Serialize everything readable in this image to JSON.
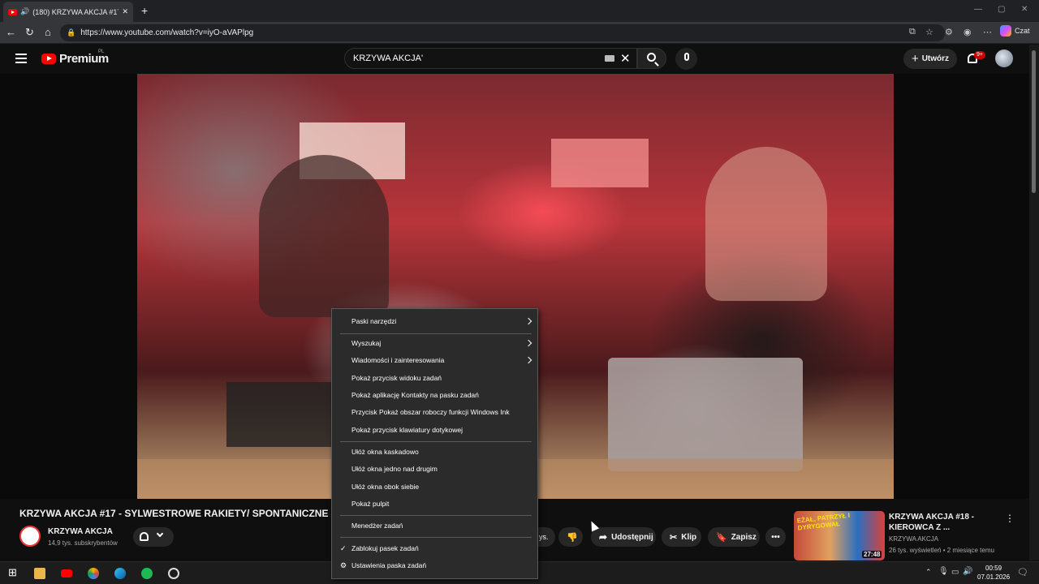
{
  "browser": {
    "tab_title": "(180) KRZYWA AKCJA #17 - SYLWESTROWE RAKIETY",
    "new_tab": "+",
    "close_tab": "✕",
    "url": "https://www.youtube.com/watch?v=iyO-aVAPlpg",
    "chat_label": "Czat",
    "window_min": "—",
    "window_max": "▢",
    "window_close": "✕"
  },
  "youtube": {
    "logo_text": "Premium",
    "logo_region": "PL",
    "search_value": "KRZYWA AKCJA'",
    "create_label": "Utwórz",
    "notifications_badge": "9+"
  },
  "video": {
    "title": "KRZYWA AKCJA #17 - SYLWESTROWE RAKIETY/ SPONTANICZNE",
    "channel_name": "KRZYWA AKCJA",
    "subscribers": "14,9 tys. subskrybentów",
    "likes_fragment": "ys.",
    "share_label": "Udostępnij",
    "clip_label": "Klip",
    "save_label": "Zapisz",
    "more_label": "•••"
  },
  "recommendation": {
    "thumb_text": "EŻAŁ, PATRZYŁ I DYRYGOWAŁ",
    "duration": "27:48",
    "title": "KRZYWA AKCJA #18 - KIEROWCA Z ...",
    "channel": "KRZYWA AKCJA",
    "meta": "26 tys. wyświetleń • 2 miesiące temu",
    "menu": "⋮"
  },
  "context_menu": {
    "items": [
      {
        "label": "Paski narzędzi",
        "submenu": true
      },
      {
        "label": "Wyszukaj",
        "submenu": true
      },
      {
        "label": "Wiadomości i zainteresowania",
        "submenu": true
      },
      {
        "label": "Pokaż przycisk widoku zadań"
      },
      {
        "label": "Pokaż aplikację Kontakty na pasku zadań"
      },
      {
        "label": "Przycisk Pokaż obszar roboczy funkcji Windows Ink"
      },
      {
        "label": "Pokaż przycisk klawiatury dotykowej"
      },
      {
        "label": "Ułóż okna kaskadowo"
      },
      {
        "label": "Ułóż okna jedno nad drugim"
      },
      {
        "label": "Ułóż okna obok siebie"
      },
      {
        "label": "Pokaż pulpit"
      },
      {
        "label": "Menedżer zadań"
      },
      {
        "label": "Zablokuj pasek zadań",
        "checked": true
      },
      {
        "label": "Ustawienia paska zadań",
        "icon": "gear-icon"
      }
    ]
  },
  "taskbar": {
    "time": "00:59",
    "date": "07.01.2026"
  },
  "colors": {
    "youtube_red": "#ff0000",
    "background": "#0f0f0f",
    "menu_bg": "#2b2b2b"
  }
}
